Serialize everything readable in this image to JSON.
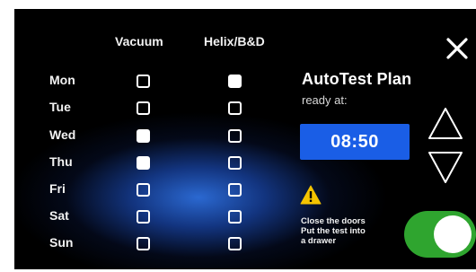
{
  "headers": {
    "vacuum": "Vacuum",
    "helix": "Helix/B&D"
  },
  "days": [
    {
      "label": "Mon",
      "vacuum": false,
      "helix": true
    },
    {
      "label": "Tue",
      "vacuum": false,
      "helix": false
    },
    {
      "label": "Wed",
      "vacuum": true,
      "helix": false
    },
    {
      "label": "Thu",
      "vacuum": true,
      "helix": false
    },
    {
      "label": "Fri",
      "vacuum": false,
      "helix": false
    },
    {
      "label": "Sat",
      "vacuum": false,
      "helix": false
    },
    {
      "label": "Sun",
      "vacuum": false,
      "helix": false
    }
  ],
  "plan": {
    "title": "AutoTest Plan",
    "subtitle": "ready at:",
    "time": "08:50"
  },
  "warning": {
    "line1": "Close the doors",
    "line2": "Put the test into",
    "line3": "a drawer"
  },
  "toggle": {
    "on": true
  },
  "colors": {
    "accent_blue": "#1a5ee6",
    "toggle_green": "#2fa52f",
    "warning_yellow": "#f5c400",
    "background": "#000000"
  },
  "icons": {
    "close": "close-icon",
    "up": "arrow-up-icon",
    "down": "arrow-down-icon",
    "warning": "warning-icon"
  }
}
